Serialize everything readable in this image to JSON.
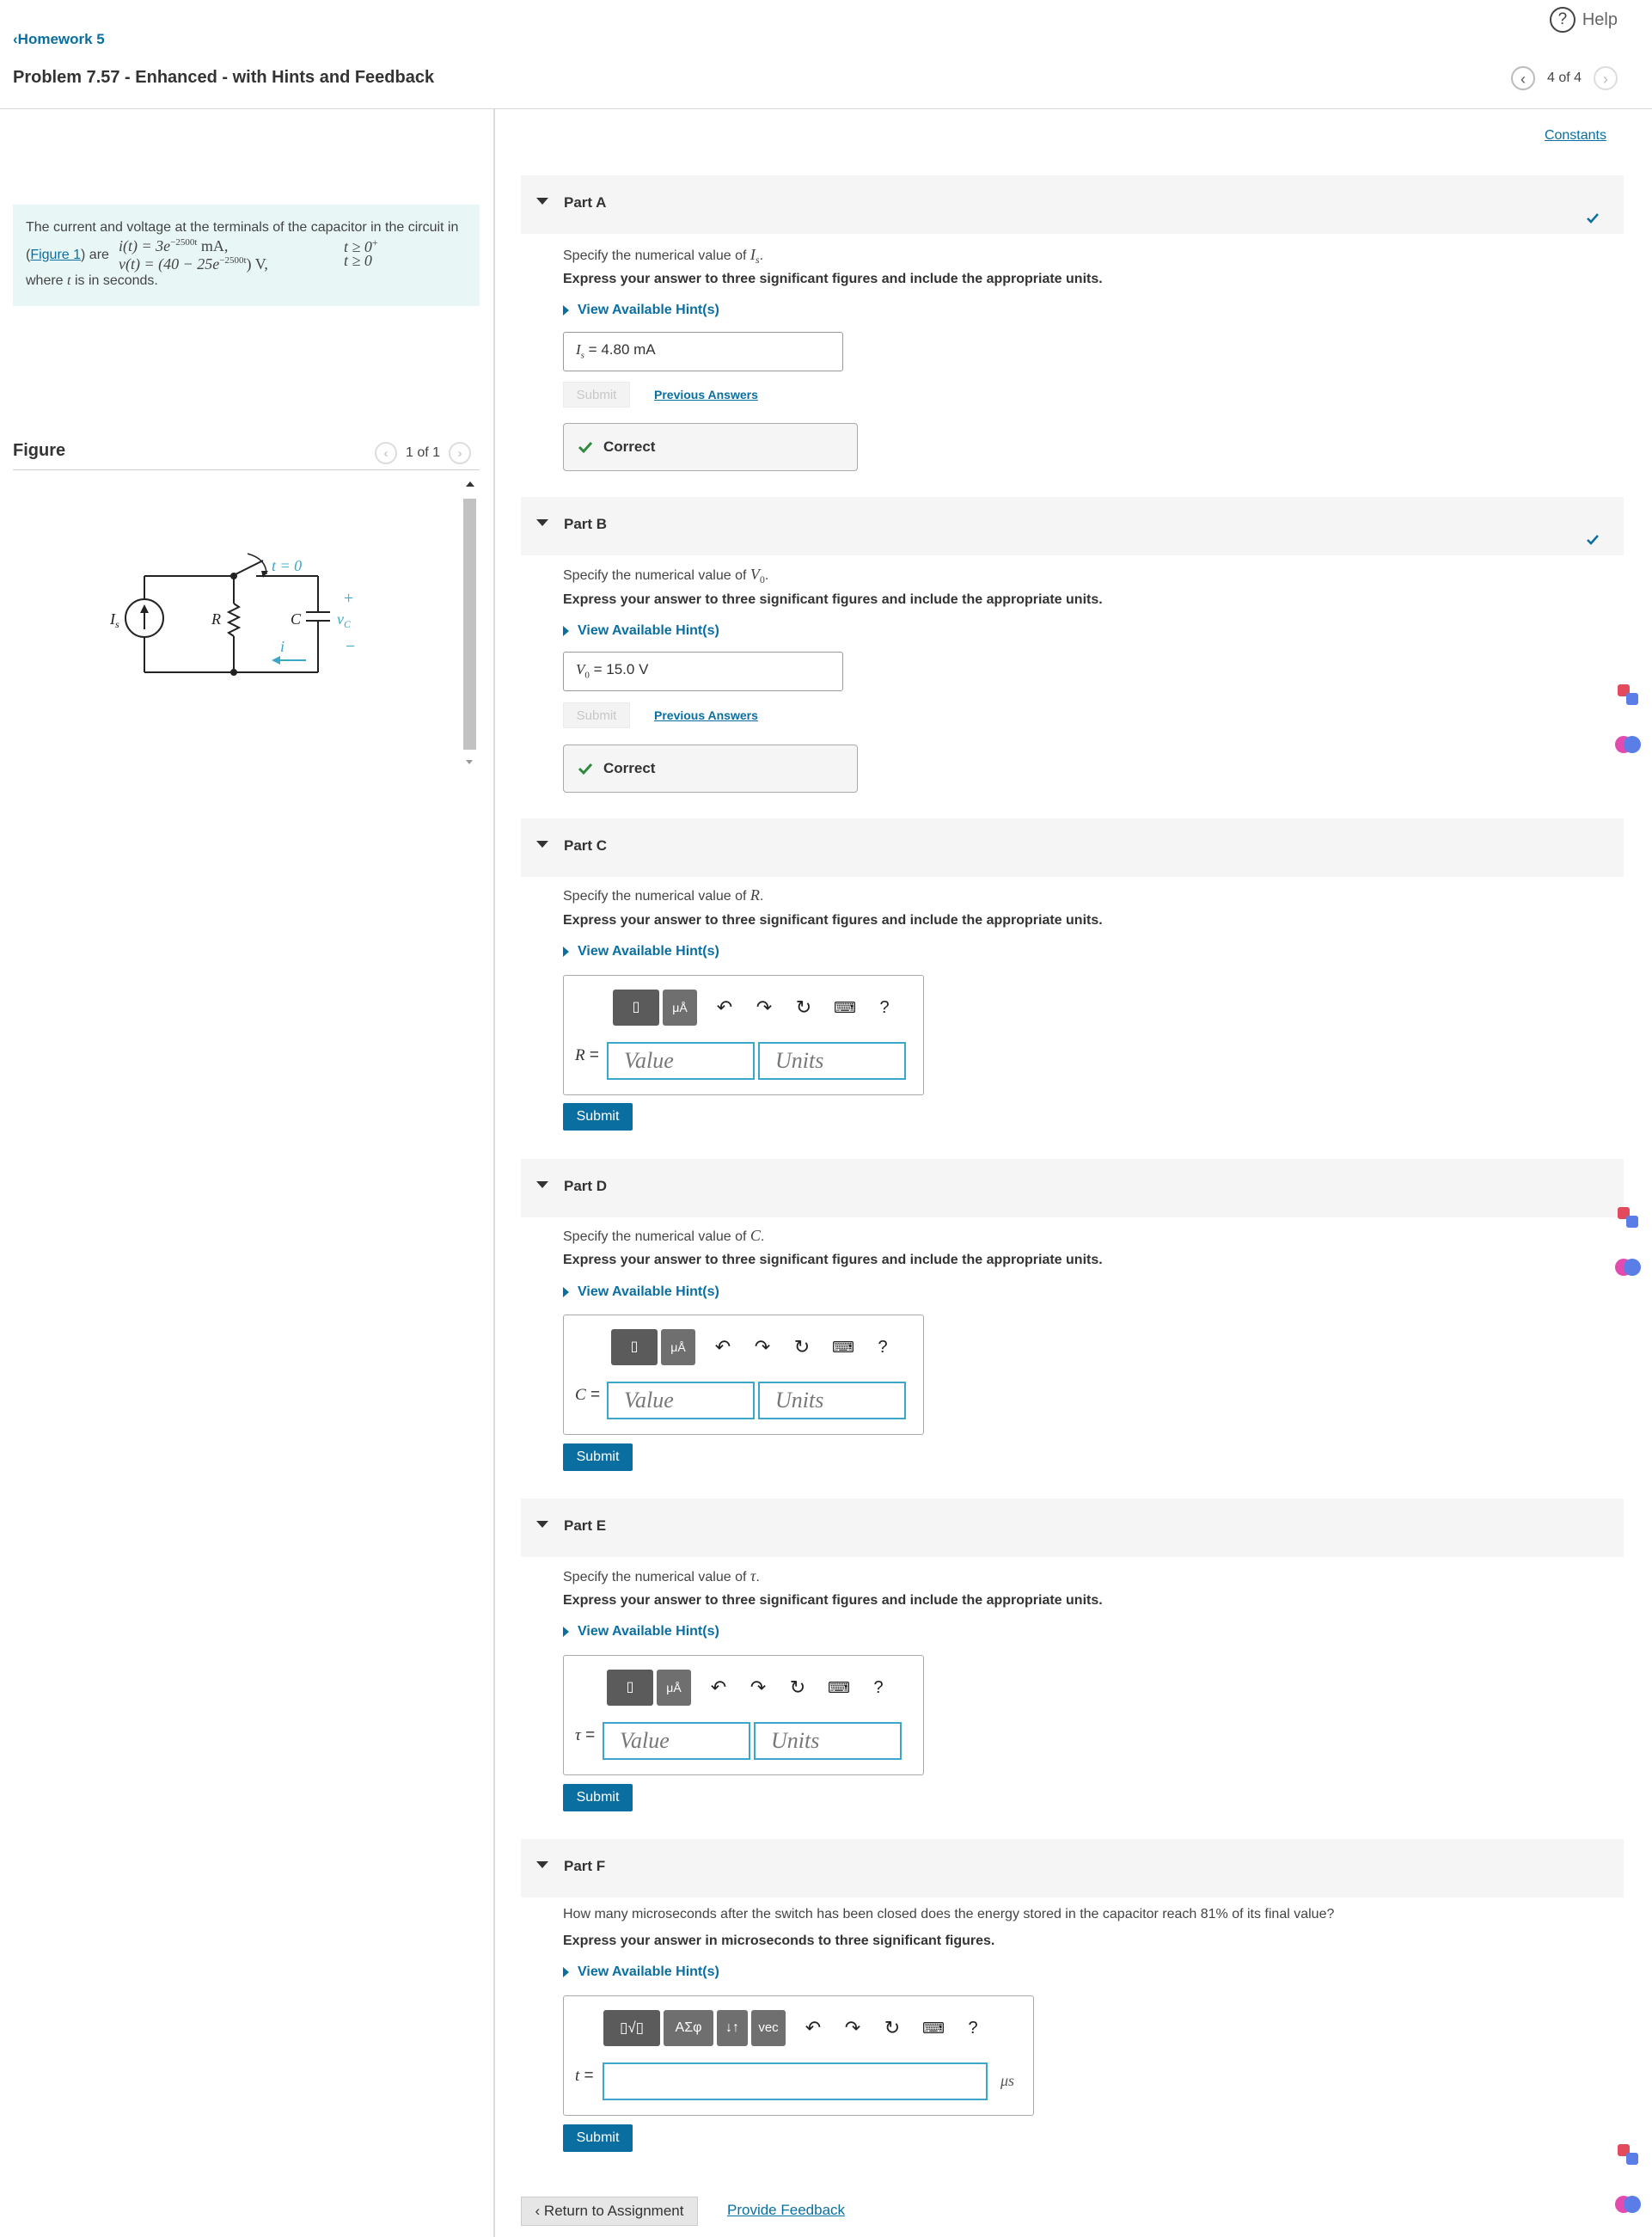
{
  "header": {
    "back_label": "Homework 5",
    "help_label": "Help",
    "title": "Problem 7.57 - Enhanced - with Hints and Feedback",
    "pager_text": "4 of 4"
  },
  "intro": {
    "line1": "The current and voltage at the terminals of the capacitor in the circuit in",
    "figure_link": "Figure 1",
    "are": ") are",
    "eq_i": "i(t) = 3e",
    "eq_i_exp": "−2500t",
    "eq_i_unit": " mA,",
    "eq_i_cond": "t ≥ 0",
    "eq_i_cond_sup": "+",
    "eq_v": "v(t) = (40 − 25e",
    "eq_v_exp": "−2500t",
    "eq_v_unit": ") V,",
    "eq_v_cond": "t ≥ 0",
    "where": "where",
    "where_var": "t",
    "where_rest": "is in seconds."
  },
  "figure": {
    "title": "Figure",
    "pager_text": "1 of 1",
    "circuit": {
      "switch_label": "t = 0",
      "source_label": "I",
      "source_sub": "s",
      "resistor_label": "R",
      "capacitor_label": "C",
      "voltage_label": "v",
      "voltage_sub": "C",
      "plus": "+",
      "minus": "−",
      "current_label": "i"
    }
  },
  "constants_label": "Constants",
  "common": {
    "hint_label": "View Available Hint(s)",
    "submit_label": "Submit",
    "prev_answers": "Previous Answers",
    "correct_label": "Correct",
    "value_placeholder": "Value",
    "units_placeholder": "Units",
    "instruction_3sf": "Express your answer to three significant figures and include the appropriate units.",
    "specify_prefix": "Specify the numerical value of",
    "toolbar_templates": "▯",
    "toolbar_units": "μÅ",
    "toolbar_help": "?"
  },
  "parts": {
    "a": {
      "title": "Part A",
      "var": "I",
      "var_sub": "s",
      "answer_value": "4.80 mA"
    },
    "b": {
      "title": "Part B",
      "var": "V",
      "var_sub": "0",
      "answer_value": "15.0 V"
    },
    "c": {
      "title": "Part C",
      "var": "R"
    },
    "d": {
      "title": "Part D",
      "var": "C"
    },
    "e": {
      "title": "Part E",
      "var": "τ"
    },
    "f": {
      "title": "Part F",
      "question": "How many microseconds after the switch has been closed does the energy stored in the capacitor reach 81% of its final value?",
      "instruction": "Express your answer in microseconds to three significant figures.",
      "var": "t",
      "unit": "μs",
      "tb_greek": "ΑΣφ",
      "tb_arrows": "↓↑",
      "tb_vec": "vec"
    }
  },
  "footer": {
    "return_label": "Return to Assignment",
    "feedback_label": "Provide Feedback"
  },
  "colors": {
    "accent": "#0a6fa0",
    "input_border": "#3aa6c9",
    "correct": "#2e8b3e",
    "intro_bg": "#e8f6f6"
  }
}
